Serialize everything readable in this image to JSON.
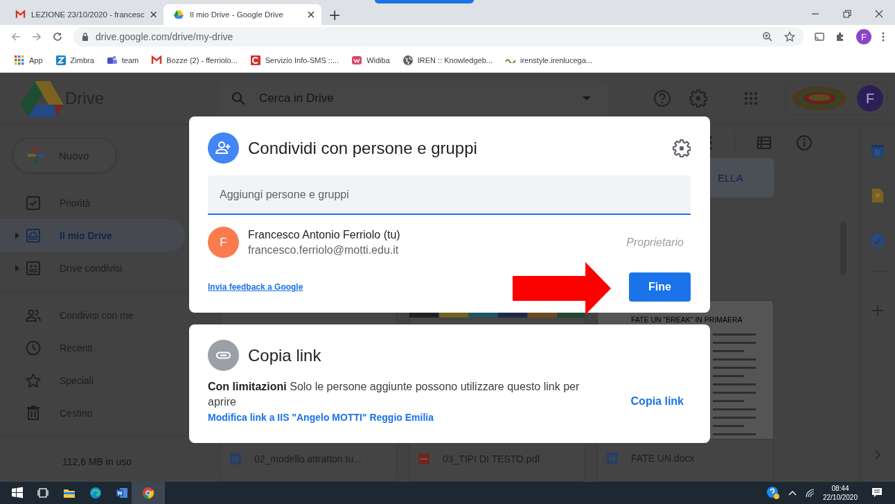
{
  "browser": {
    "tabs": [
      {
        "title": "LEZIONE 23/10/2020 - francesc",
        "kind": "mail",
        "selected": false
      },
      {
        "title": "Il mio Drive - Google Drive",
        "kind": "drive",
        "selected": true
      }
    ],
    "new_tab": "+",
    "address": "drive.google.com/drive/my-drive",
    "profile_initial": "F",
    "bookmarks": [
      {
        "label": "App",
        "kind": "apps"
      },
      {
        "label": "Zimbra",
        "kind": "zimbra"
      },
      {
        "label": "team",
        "kind": "teams"
      },
      {
        "label": "Bozze (2) - fferriolo...",
        "kind": "mail"
      },
      {
        "label": "Servizio Info-SMS ::...",
        "kind": "sms"
      },
      {
        "label": "Widiba",
        "kind": "widiba"
      },
      {
        "label": "IREN :: Knowledgeb...",
        "kind": "globe"
      },
      {
        "label": "irenstyle.irenlucega...",
        "kind": "iren"
      }
    ]
  },
  "drive": {
    "logo_text": "Drive",
    "search": {
      "placeholder": "Cerca in Drive"
    },
    "account_initial": "F",
    "new_button": "Nuovo",
    "nav": [
      {
        "items": [
          {
            "label": "Priorità",
            "kind": "priority",
            "expandable": false,
            "selected": false
          },
          {
            "label": "Il mio Drive",
            "kind": "my-drive",
            "expandable": true,
            "selected": true
          },
          {
            "label": "Drive condivisi",
            "kind": "shared-drives",
            "expandable": true,
            "selected": false
          }
        ]
      },
      {
        "items": [
          {
            "label": "Condivisi con me",
            "kind": "shared",
            "expandable": false,
            "selected": false
          },
          {
            "label": "Recenti",
            "kind": "recent",
            "expandable": false,
            "selected": false
          },
          {
            "label": "Speciali",
            "kind": "starred",
            "expandable": false,
            "selected": false
          },
          {
            "label": "Cestino",
            "kind": "trash",
            "expandable": false,
            "selected": false
          }
        ]
      }
    ],
    "storage": "112,6 MB in uso",
    "folder": "ELLA",
    "files": [
      {
        "name": "02_modello attrattori tu...",
        "kind": "word",
        "color_stripes": false
      },
      {
        "name": "03_TIPI DI TESTO.pdf",
        "kind": "pdf",
        "color_stripes": true
      },
      {
        "name": "FATE UN.docx",
        "kind": "word",
        "color_stripes": false,
        "preview_heading": "FATE UN \"BREAK\" IN PRIMAERA"
      }
    ]
  },
  "share_dialog": {
    "title": "Condividi con persone e gruppi",
    "input_placeholder": "Aggiungi persone e gruppi",
    "people": [
      {
        "initial": "F",
        "name": "Francesco Antonio Ferriolo (tu)",
        "email": "francesco.ferriolo@motti.edu.it",
        "role": "Proprietario"
      }
    ],
    "feedback_link": "Invia feedback a Google",
    "done_button": "Fine"
  },
  "link_dialog": {
    "title": "Copia link",
    "description": "**Con limitazioni** Solo le persone aggiunte possono utilizzare questo link per aprire",
    "change_link": "Modifica link a IIS \"Angelo MOTTI\" Reggio Emilia",
    "copy_button": "Copia link"
  },
  "taskbar": {
    "apps": [
      {
        "kind": "start",
        "selected": false
      },
      {
        "kind": "task-view",
        "selected": false
      },
      {
        "kind": "explorer",
        "selected": false
      },
      {
        "kind": "edge",
        "selected": false
      },
      {
        "kind": "word",
        "selected": false
      },
      {
        "kind": "chrome",
        "selected": true
      }
    ],
    "time": "08:44",
    "date": "22/10/2020"
  }
}
